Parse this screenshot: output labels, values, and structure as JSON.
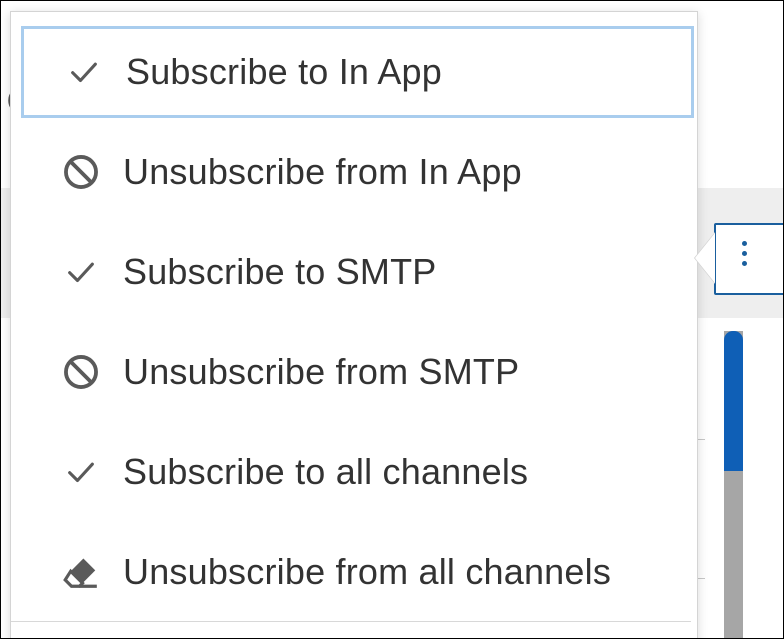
{
  "background": {
    "kebab_button_label": "⋮"
  },
  "menu": {
    "items": [
      {
        "label": "Subscribe to In App",
        "icon": "check-icon",
        "focused": true
      },
      {
        "label": "Unsubscribe from In App",
        "icon": "ban-icon",
        "focused": false
      },
      {
        "label": "Subscribe to SMTP",
        "icon": "check-icon",
        "focused": false
      },
      {
        "label": "Unsubscribe from SMTP",
        "icon": "ban-icon",
        "focused": false
      },
      {
        "label": "Subscribe to all channels",
        "icon": "check-icon",
        "focused": false
      },
      {
        "label": "Unsubscribe from all channels",
        "icon": "eraser-icon",
        "focused": false
      }
    ]
  },
  "colors": {
    "text": "#333333",
    "icon": "#5a5a5a",
    "focus_ring": "#a9cdee",
    "accent_blue": "#1a5f9e",
    "scroll_thumb": "#0f5fb6"
  }
}
